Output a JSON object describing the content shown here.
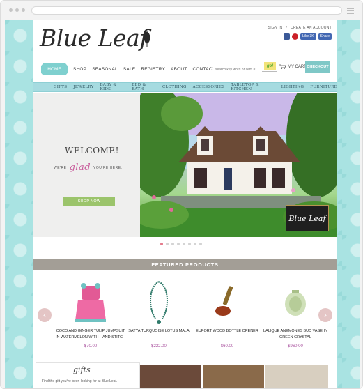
{
  "header": {
    "sign_in": "SIGN IN",
    "separator": "/",
    "create_account": "CREATE AN ACCOUNT",
    "logo_text": "Blue Leaf",
    "like_label": "Like 3K",
    "share_label": "Share"
  },
  "nav": {
    "items": [
      "HOME",
      "SHOP",
      "SEASONAL",
      "SALE",
      "REGISTRY",
      "ABOUT",
      "CONTACT"
    ],
    "search_placeholder": "search key word or item #",
    "go_label": "go!",
    "cart_label": "MY CART",
    "checkout_label": "CHECKOUT"
  },
  "categories": [
    "GIFTS",
    "JEWELRY",
    "BABY & KIDS",
    "BED & BATH",
    "CLOTHING",
    "ACCESSORIES",
    "TABLETOP & KITCHEN",
    "LIGHTING",
    "FURNITURE"
  ],
  "hero": {
    "welcome": "WELCOME!",
    "line_left": "WE'RE",
    "glad": "glad",
    "line_right": "YOU'RE HERE.",
    "shop_now": "SHOP NOW",
    "badge_text": "Blue Leaf",
    "slide_count": 8,
    "active_slide": 1
  },
  "featured": {
    "title": "FEATURED PRODUCTS",
    "products": [
      {
        "name": "COCO AND GINGER TULIP JUMPSUIT IN WATERMELON WITH HAND STITCH",
        "price": "$70.00"
      },
      {
        "name": "SATYA TURQUOISE LOTUS MALA",
        "price": "$222.00"
      },
      {
        "name": "EUPORT WOOD BOTTLE OPENER",
        "price": "$60.00"
      },
      {
        "name": "LALIQUE ANEMONES BUD VASE IN GREEN CRYSTAL",
        "price": "$960.00"
      }
    ]
  },
  "gifts": {
    "title": "gifts",
    "text": "Find the gift you've been looking for at Blue Leaf."
  },
  "colors": {
    "accent": "#7fd0cf",
    "category_bar": "#a6dbe0",
    "price": "#a54a9a",
    "featured_bar": "#a39e96",
    "shop_now": "#9bc46b"
  }
}
